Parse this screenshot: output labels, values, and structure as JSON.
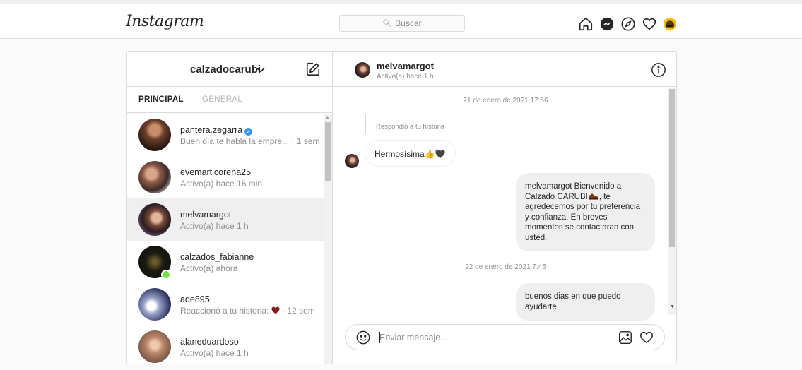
{
  "header": {
    "logo": "Instagram",
    "search_placeholder": "Buscar"
  },
  "inbox": {
    "account": "calzadocarubi",
    "tabs": [
      {
        "label": "PRINCIPAL",
        "active": true
      },
      {
        "label": "GENERAL",
        "active": false
      }
    ],
    "threads": [
      {
        "name": "pantera.zegarra",
        "verified": true,
        "subtitle": "Buen día te habla la empre... · 1 sem"
      },
      {
        "name": "evemarticorena25",
        "subtitle": "Activo(a) hace 16 min"
      },
      {
        "name": "melvamargot",
        "subtitle": "Activo(a) hace 1 h",
        "selected": true
      },
      {
        "name": "calzados_fabianne",
        "subtitle": "Activo(a) ahora",
        "online": true
      },
      {
        "name": "ade895",
        "subtitle_prefix": "Reaccionó a tu historia:",
        "subtitle_suffix": " · 12 sem"
      },
      {
        "name": "alaneduardoso",
        "subtitle": "Activo(a) hace 1 h"
      }
    ]
  },
  "chat": {
    "name": "melvamargot",
    "status": "Activo(a) hace 1 h",
    "date1": "21 de enero de 2021 17:56",
    "reply_label": "Respondió a tu historia",
    "incoming": "Hermosísima👍🖤",
    "outgoing1_a": "melvamargot Bienvenido a Calzado CARUBI",
    "outgoing1_b": ", te agredecemos por tu preferencia y confianza. En breves momentos se contactaran con usted.",
    "date2": "22 de enero de 2021 7:45",
    "outgoing2": "buenos dias en que puedo ayudarte.",
    "input_placeholder": "Enviar mensaje..."
  },
  "colors": {
    "border": "#dbdbdb",
    "muted": "#8e8e8e",
    "bubble": "#efefef",
    "verified": "#3897f0",
    "online": "#78de45"
  }
}
